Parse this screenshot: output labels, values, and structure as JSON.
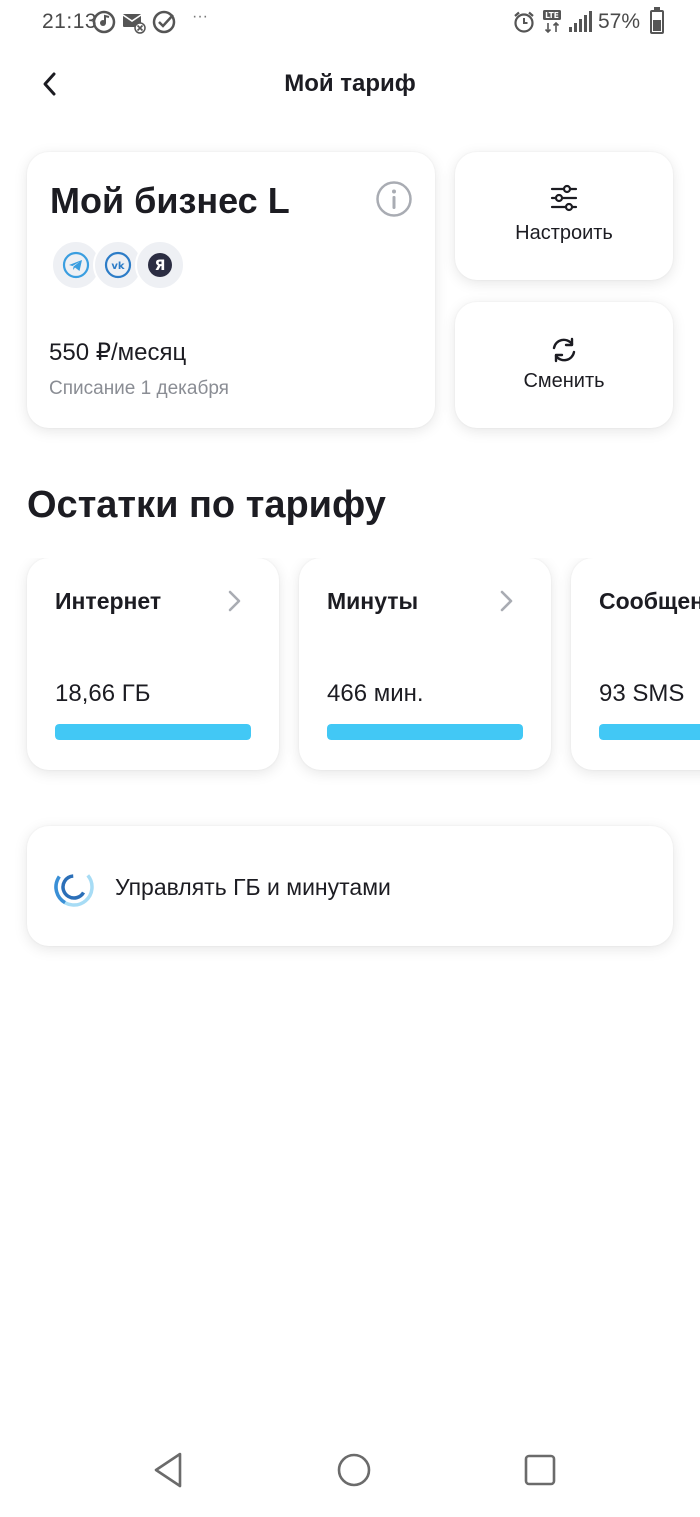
{
  "status_bar": {
    "time": "21:13",
    "battery": "57%",
    "dots": "···",
    "icons": [
      "music-icon",
      "mail-muted-icon",
      "check-circle-icon",
      "alarm-icon",
      "lte-icon",
      "signal-icon",
      "battery-icon"
    ]
  },
  "header": {
    "title": "Мой тариф",
    "back_icon": "chevron-left-icon"
  },
  "tariff": {
    "name": "Мой бизнес L",
    "price": "550 ₽/месяц",
    "charge_date": "Списание 1 декабря",
    "apps": [
      "telegram-icon",
      "vk-icon",
      "yandex-icon"
    ]
  },
  "actions": {
    "configure_label": "Настроить",
    "change_label": "Сменить"
  },
  "balances": {
    "section_title": "Остатки по тарифу",
    "items": [
      {
        "title": "Интернет",
        "value": "18,66 ГБ",
        "fill": 1.0
      },
      {
        "title": "Минуты",
        "value": "466 мин.",
        "fill": 1.0
      },
      {
        "title": "Сообщения",
        "value": "93 SMS",
        "fill": 1.0
      }
    ]
  },
  "manage": {
    "label": "Управлять ГБ и минутами"
  },
  "colors": {
    "accent_bar": "#42c8f5",
    "text_primary": "#1c1c22",
    "text_secondary": "#8a8d94"
  }
}
